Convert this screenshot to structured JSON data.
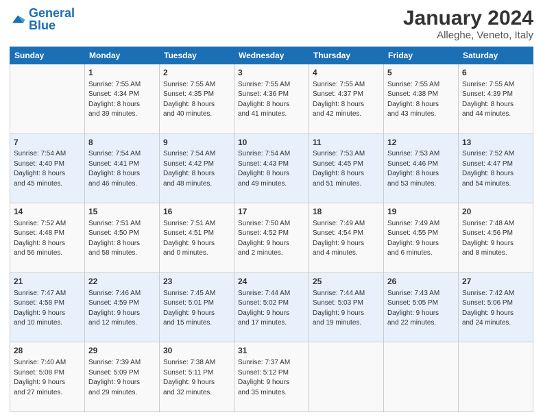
{
  "logo": {
    "text_general": "General",
    "text_blue": "Blue"
  },
  "title": "January 2024",
  "subtitle": "Alleghe, Veneto, Italy",
  "days": [
    "Sunday",
    "Monday",
    "Tuesday",
    "Wednesday",
    "Thursday",
    "Friday",
    "Saturday"
  ],
  "weeks": [
    [
      {
        "num": "",
        "lines": []
      },
      {
        "num": "1",
        "lines": [
          "Sunrise: 7:55 AM",
          "Sunset: 4:34 PM",
          "Daylight: 8 hours",
          "and 39 minutes."
        ]
      },
      {
        "num": "2",
        "lines": [
          "Sunrise: 7:55 AM",
          "Sunset: 4:35 PM",
          "Daylight: 8 hours",
          "and 40 minutes."
        ]
      },
      {
        "num": "3",
        "lines": [
          "Sunrise: 7:55 AM",
          "Sunset: 4:36 PM",
          "Daylight: 8 hours",
          "and 41 minutes."
        ]
      },
      {
        "num": "4",
        "lines": [
          "Sunrise: 7:55 AM",
          "Sunset: 4:37 PM",
          "Daylight: 8 hours",
          "and 42 minutes."
        ]
      },
      {
        "num": "5",
        "lines": [
          "Sunrise: 7:55 AM",
          "Sunset: 4:38 PM",
          "Daylight: 8 hours",
          "and 43 minutes."
        ]
      },
      {
        "num": "6",
        "lines": [
          "Sunrise: 7:55 AM",
          "Sunset: 4:39 PM",
          "Daylight: 8 hours",
          "and 44 minutes."
        ]
      }
    ],
    [
      {
        "num": "7",
        "lines": [
          "Sunrise: 7:54 AM",
          "Sunset: 4:40 PM",
          "Daylight: 8 hours",
          "and 45 minutes."
        ]
      },
      {
        "num": "8",
        "lines": [
          "Sunrise: 7:54 AM",
          "Sunset: 4:41 PM",
          "Daylight: 8 hours",
          "and 46 minutes."
        ]
      },
      {
        "num": "9",
        "lines": [
          "Sunrise: 7:54 AM",
          "Sunset: 4:42 PM",
          "Daylight: 8 hours",
          "and 48 minutes."
        ]
      },
      {
        "num": "10",
        "lines": [
          "Sunrise: 7:54 AM",
          "Sunset: 4:43 PM",
          "Daylight: 8 hours",
          "and 49 minutes."
        ]
      },
      {
        "num": "11",
        "lines": [
          "Sunrise: 7:53 AM",
          "Sunset: 4:45 PM",
          "Daylight: 8 hours",
          "and 51 minutes."
        ]
      },
      {
        "num": "12",
        "lines": [
          "Sunrise: 7:53 AM",
          "Sunset: 4:46 PM",
          "Daylight: 8 hours",
          "and 53 minutes."
        ]
      },
      {
        "num": "13",
        "lines": [
          "Sunrise: 7:52 AM",
          "Sunset: 4:47 PM",
          "Daylight: 8 hours",
          "and 54 minutes."
        ]
      }
    ],
    [
      {
        "num": "14",
        "lines": [
          "Sunrise: 7:52 AM",
          "Sunset: 4:48 PM",
          "Daylight: 8 hours",
          "and 56 minutes."
        ]
      },
      {
        "num": "15",
        "lines": [
          "Sunrise: 7:51 AM",
          "Sunset: 4:50 PM",
          "Daylight: 8 hours",
          "and 58 minutes."
        ]
      },
      {
        "num": "16",
        "lines": [
          "Sunrise: 7:51 AM",
          "Sunset: 4:51 PM",
          "Daylight: 9 hours",
          "and 0 minutes."
        ]
      },
      {
        "num": "17",
        "lines": [
          "Sunrise: 7:50 AM",
          "Sunset: 4:52 PM",
          "Daylight: 9 hours",
          "and 2 minutes."
        ]
      },
      {
        "num": "18",
        "lines": [
          "Sunrise: 7:49 AM",
          "Sunset: 4:54 PM",
          "Daylight: 9 hours",
          "and 4 minutes."
        ]
      },
      {
        "num": "19",
        "lines": [
          "Sunrise: 7:49 AM",
          "Sunset: 4:55 PM",
          "Daylight: 9 hours",
          "and 6 minutes."
        ]
      },
      {
        "num": "20",
        "lines": [
          "Sunrise: 7:48 AM",
          "Sunset: 4:56 PM",
          "Daylight: 9 hours",
          "and 8 minutes."
        ]
      }
    ],
    [
      {
        "num": "21",
        "lines": [
          "Sunrise: 7:47 AM",
          "Sunset: 4:58 PM",
          "Daylight: 9 hours",
          "and 10 minutes."
        ]
      },
      {
        "num": "22",
        "lines": [
          "Sunrise: 7:46 AM",
          "Sunset: 4:59 PM",
          "Daylight: 9 hours",
          "and 12 minutes."
        ]
      },
      {
        "num": "23",
        "lines": [
          "Sunrise: 7:45 AM",
          "Sunset: 5:01 PM",
          "Daylight: 9 hours",
          "and 15 minutes."
        ]
      },
      {
        "num": "24",
        "lines": [
          "Sunrise: 7:44 AM",
          "Sunset: 5:02 PM",
          "Daylight: 9 hours",
          "and 17 minutes."
        ]
      },
      {
        "num": "25",
        "lines": [
          "Sunrise: 7:44 AM",
          "Sunset: 5:03 PM",
          "Daylight: 9 hours",
          "and 19 minutes."
        ]
      },
      {
        "num": "26",
        "lines": [
          "Sunrise: 7:43 AM",
          "Sunset: 5:05 PM",
          "Daylight: 9 hours",
          "and 22 minutes."
        ]
      },
      {
        "num": "27",
        "lines": [
          "Sunrise: 7:42 AM",
          "Sunset: 5:06 PM",
          "Daylight: 9 hours",
          "and 24 minutes."
        ]
      }
    ],
    [
      {
        "num": "28",
        "lines": [
          "Sunrise: 7:40 AM",
          "Sunset: 5:08 PM",
          "Daylight: 9 hours",
          "and 27 minutes."
        ]
      },
      {
        "num": "29",
        "lines": [
          "Sunrise: 7:39 AM",
          "Sunset: 5:09 PM",
          "Daylight: 9 hours",
          "and 29 minutes."
        ]
      },
      {
        "num": "30",
        "lines": [
          "Sunrise: 7:38 AM",
          "Sunset: 5:11 PM",
          "Daylight: 9 hours",
          "and 32 minutes."
        ]
      },
      {
        "num": "31",
        "lines": [
          "Sunrise: 7:37 AM",
          "Sunset: 5:12 PM",
          "Daylight: 9 hours",
          "and 35 minutes."
        ]
      },
      {
        "num": "",
        "lines": []
      },
      {
        "num": "",
        "lines": []
      },
      {
        "num": "",
        "lines": []
      }
    ]
  ]
}
